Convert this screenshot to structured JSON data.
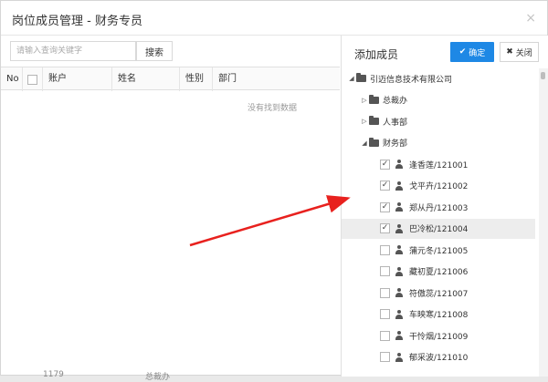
{
  "dialog": {
    "title": "岗位成员管理 - 财务专员",
    "close_glyph": "×"
  },
  "left": {
    "search_placeholder": "请输入查询关键字",
    "search_button": "搜索",
    "columns": [
      "No",
      "账户",
      "姓名",
      "性别",
      "部门"
    ],
    "empty_text": "没有找到数据",
    "ghost_a": "1179",
    "ghost_b": "总裁办"
  },
  "right": {
    "title": "添加成员",
    "confirm_label": "确定",
    "close_label": "关闭",
    "tree": [
      {
        "type": "org",
        "label": "引迈信息技术有限公司",
        "level": 0,
        "expanded": true
      },
      {
        "type": "dept",
        "label": "总裁办",
        "level": 1,
        "expanded": false
      },
      {
        "type": "dept",
        "label": "人事部",
        "level": 1,
        "expanded": false
      },
      {
        "type": "dept",
        "label": "财务部",
        "level": 1,
        "expanded": true
      },
      {
        "type": "user",
        "label": "逢香莲/121001",
        "checked": true,
        "selected": false
      },
      {
        "type": "user",
        "label": "戈平卉/121002",
        "checked": true,
        "selected": false
      },
      {
        "type": "user",
        "label": "郑从丹/121003",
        "checked": true,
        "selected": false
      },
      {
        "type": "user",
        "label": "巴冷松/121004",
        "checked": true,
        "selected": true
      },
      {
        "type": "user",
        "label": "蒲元冬/121005",
        "checked": false,
        "selected": false
      },
      {
        "type": "user",
        "label": "藏初夏/121006",
        "checked": false,
        "selected": false
      },
      {
        "type": "user",
        "label": "符傲蕊/121007",
        "checked": false,
        "selected": false
      },
      {
        "type": "user",
        "label": "车映寒/121008",
        "checked": false,
        "selected": false
      },
      {
        "type": "user",
        "label": "干怜烟/121009",
        "checked": false,
        "selected": false
      },
      {
        "type": "user",
        "label": "郁采波/121010",
        "checked": false,
        "selected": false
      }
    ]
  },
  "colors": {
    "accent": "#1e88e5",
    "arrow": "#e8211e"
  }
}
